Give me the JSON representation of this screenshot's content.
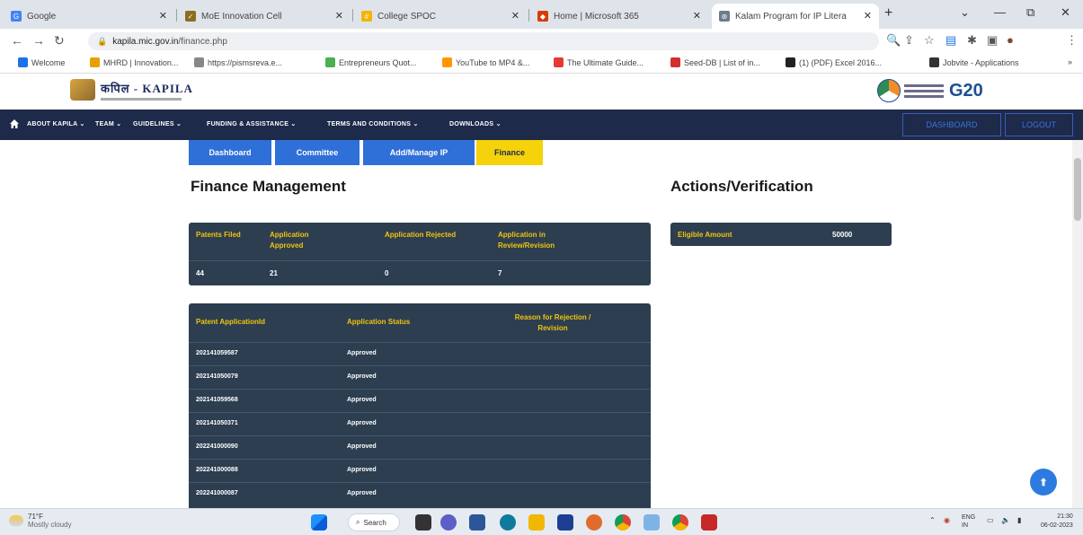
{
  "browser": {
    "tabs": [
      {
        "title": "Google",
        "color": "#4285f4",
        "glyph": "G"
      },
      {
        "title": "MoE Innovation Cell",
        "color": "#8c6d1f",
        "glyph": "✓"
      },
      {
        "title": "College SPOC",
        "color": "#f4b400",
        "glyph": "#"
      },
      {
        "title": "Home | Microsoft 365",
        "color": "#d83b01",
        "glyph": "◆"
      },
      {
        "title": "Kalam Program for IP Litera",
        "color": "#6b7b8c",
        "glyph": "⊛"
      }
    ],
    "url_host": "kapila.mic.gov.in",
    "url_path": "/finance.php",
    "bookmarks": [
      {
        "label": "Welcome",
        "color": "#1a73e8"
      },
      {
        "label": "MHRD | Innovation...",
        "color": "#e6a000"
      },
      {
        "label": "https://pismsreva.e...",
        "color": "#888888"
      },
      {
        "label": "Entrepreneurs Quot...",
        "color": "#4caf50"
      },
      {
        "label": "YouTube to MP4 &...",
        "color": "#ff9800"
      },
      {
        "label": "The Ultimate Guide...",
        "color": "#e53935"
      },
      {
        "label": "Seed-DB | List of in...",
        "color": "#d32f2f"
      },
      {
        "label": "(1) (PDF) Excel 2016...",
        "color": "#222222"
      },
      {
        "label": "Jobvite - Applications",
        "color": "#333333"
      }
    ]
  },
  "site": {
    "logo_text": "कपिल - KAPILA",
    "nav": [
      "ABOUT KAPILA ⌄",
      "TEAM ⌄",
      "GUIDELINES ⌄",
      "FUNDING & ASSISTANCE ⌄",
      "TERMS AND CONDITIONS ⌄",
      "DOWNLOADS ⌄"
    ],
    "dashboard_btn": "DASHBOARD",
    "logout_btn": "LOGOUT",
    "g20_text": "G20",
    "subtabs": [
      "Dashboard",
      "Committee",
      "Add/Manage IP",
      "Finance"
    ]
  },
  "finance": {
    "title": "Finance Management",
    "summary_headers": [
      "Patents Filed",
      "Application Approved",
      "Application Rejected",
      "Application in Review/Revision"
    ],
    "summary_values": [
      "44",
      "21",
      "0",
      "7"
    ],
    "table_headers": [
      "Patent ApplicationId",
      "Application Status",
      "Reason for Rejection / Revision"
    ],
    "rows": [
      {
        "id": "202141059587",
        "status": "Approved"
      },
      {
        "id": "202141050079",
        "status": "Approved"
      },
      {
        "id": "202141059568",
        "status": "Approved"
      },
      {
        "id": "202141050371",
        "status": "Approved"
      },
      {
        "id": "202241000090",
        "status": "Approved"
      },
      {
        "id": "202241000088",
        "status": "Approved"
      },
      {
        "id": "202241000087",
        "status": "Approved"
      }
    ]
  },
  "actions": {
    "title": "Actions/Verification",
    "eligible_label": "Eligible Amount",
    "eligible_value": "50000"
  },
  "taskbar": {
    "weather_temp": "71°F",
    "weather_desc": "Mostly cloudy",
    "search_label": "Search",
    "lang": "ENG",
    "lang_sub": "IN",
    "time": "21:30",
    "date": "06-02-2023"
  }
}
